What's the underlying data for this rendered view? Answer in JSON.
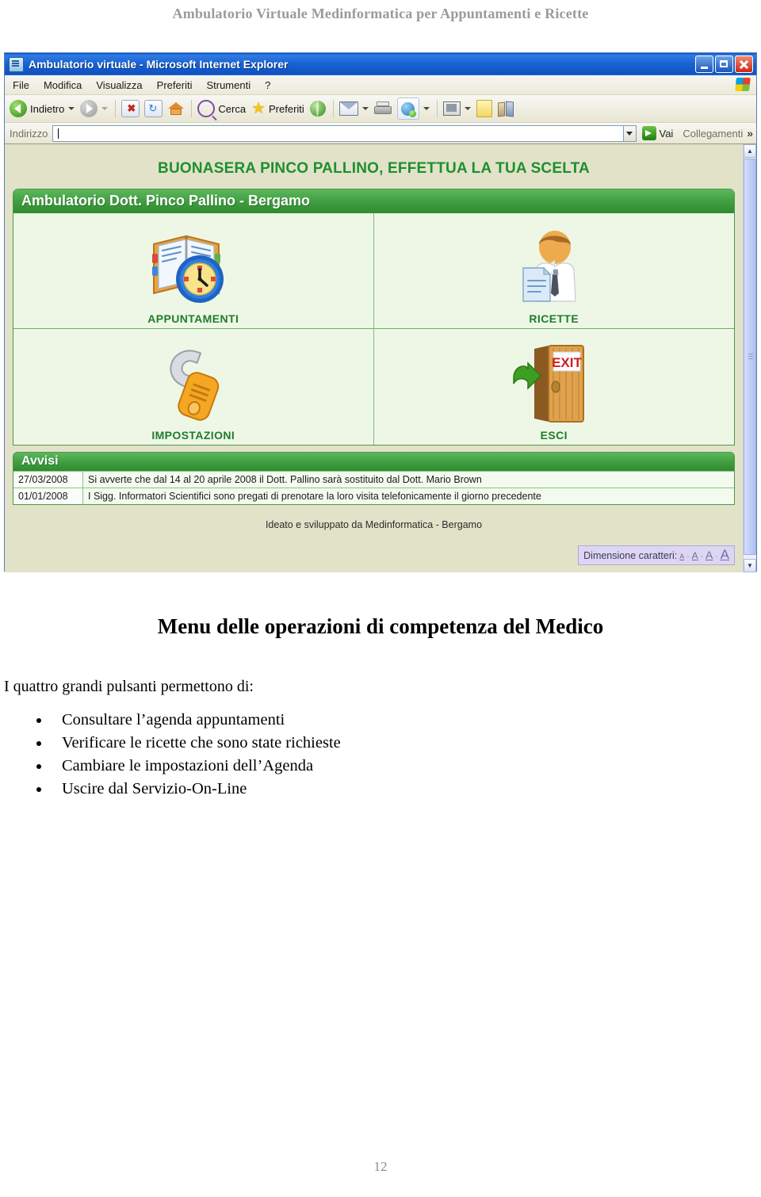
{
  "document": {
    "header_title": "Ambulatorio Virtuale Medinformatica per Appuntamenti e Ricette",
    "section_title": "Menu delle operazioni di competenza del Medico",
    "intro": "I quattro grandi pulsanti permettono di:",
    "bullets": [
      "Consultare l’agenda appuntamenti",
      "Verificare le ricette che sono state richieste",
      "Cambiare le impostazioni dell’Agenda",
      "Uscire dal Servizio-On-Line"
    ],
    "page_number": "12"
  },
  "browser": {
    "window_title": "Ambulatorio virtuale - Microsoft Internet Explorer",
    "menu": [
      "File",
      "Modifica",
      "Visualizza",
      "Preferiti",
      "Strumenti",
      "?"
    ],
    "window_buttons": {
      "minimize": "minimize-icon",
      "restore": "restore-icon",
      "close": "close-icon"
    },
    "toolbar": {
      "back_label": "Indietro",
      "search_label": "Cerca",
      "favorites_label": "Preferiti",
      "icons": [
        "back-icon",
        "forward-icon",
        "stop-icon",
        "refresh-icon",
        "home-icon",
        "search-icon",
        "favorites-star-icon",
        "history-icon",
        "mail-icon",
        "print-icon",
        "messenger-icon",
        "edit-icon",
        "notes-icon",
        "research-icon"
      ]
    },
    "address": {
      "label": "Indirizzo",
      "value": "",
      "placeholder": "",
      "go_label": "Vai",
      "links_label": "Collegamenti",
      "overflow_glyph": "»"
    }
  },
  "page": {
    "greeting": "BUONASERA PINCO PALLINO, EFFETTUA LA TUA SCELTA",
    "panel_title": "Ambulatorio Dott. Pinco Pallino - Bergamo",
    "buttons": [
      {
        "label": "APPUNTAMENTI",
        "icon": "agenda-clock-icon"
      },
      {
        "label": "RICETTE",
        "icon": "doctor-document-icon"
      },
      {
        "label": "IMPOSTAZIONI",
        "icon": "wrench-icon"
      },
      {
        "label": "ESCI",
        "icon": "exit-door-icon"
      }
    ],
    "notices": {
      "title": "Avvisi",
      "rows": [
        {
          "date": "27/03/2008",
          "text": "Si avverte che dal 14 al 20 aprile 2008 il Dott. Pallino sarà sostituito dal Dott. Mario Brown"
        },
        {
          "date": "01/01/2008",
          "text": "I Sigg. Informatori Scientifici sono pregati di prenotare la loro visita telefonicamente il giorno precedente"
        }
      ]
    },
    "footer": "Ideato e sviluppato da Medinformatica - Bergamo",
    "font_size": {
      "label": "Dimensione caratteri:",
      "options": [
        "A",
        "A",
        "A",
        "A"
      ]
    }
  },
  "colors": {
    "brand_green": "#2e8c2e",
    "greeting_green": "#1e8f2e",
    "panel_bg": "#eef7e6",
    "page_bg": "#e2e2c9",
    "titlebar_blue": "#1a63d6",
    "exit_red": "#c0281b"
  }
}
